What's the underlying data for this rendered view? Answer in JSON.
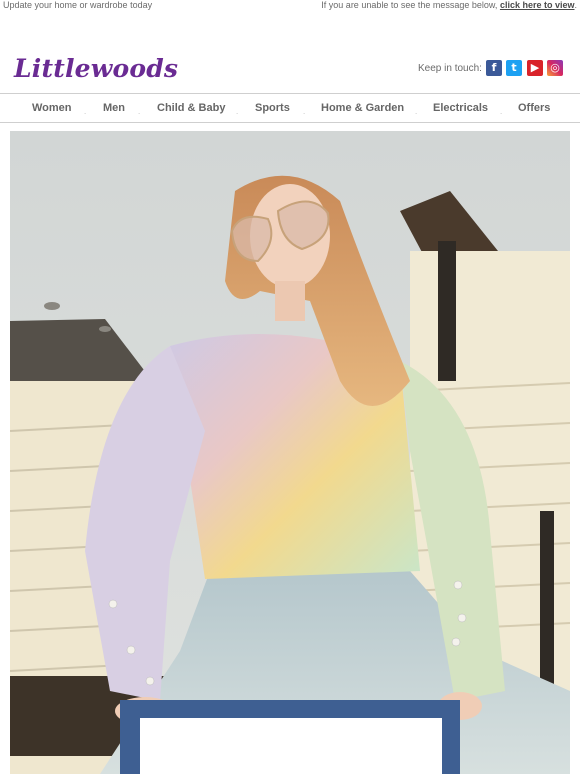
{
  "preheader": {
    "left_text": "Update your home or wardrobe today",
    "right_text": "If you are unable to see the message below,",
    "right_link": "click here to view",
    "right_end": "."
  },
  "header": {
    "logo": "Littlewoods",
    "keep_in_touch": "Keep in touch:",
    "social": [
      {
        "name": "facebook-icon",
        "glyph": "f"
      },
      {
        "name": "twitter-icon",
        "glyph": "t"
      },
      {
        "name": "youtube-icon",
        "glyph": "▶"
      },
      {
        "name": "instagram-icon",
        "glyph": "◎"
      }
    ]
  },
  "nav": {
    "items": [
      "Women",
      "Men",
      "Child & Baby",
      "Sports",
      "Home & Garden",
      "Electricals",
      "Offers"
    ]
  },
  "hero": {
    "image_alt": "Model in pastel knit jumper sitting in front of beach huts"
  },
  "colors": {
    "brand": "#6a2b93",
    "panel": "#3e5f92"
  }
}
